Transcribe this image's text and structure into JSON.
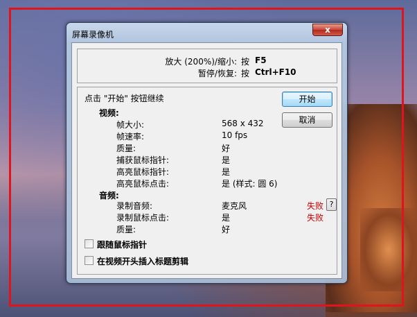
{
  "window": {
    "title": "屏幕录像机",
    "close_glyph": "x"
  },
  "hotkeys": {
    "zoom_label": "放大 (200%)/缩小:",
    "zoom_press": "按",
    "zoom_key": "F5",
    "pause_label": "暂停/恢复:",
    "pause_press": "按",
    "pause_key": "Ctrl+F10"
  },
  "instruction": "点击 \"开始\" 按钮继续",
  "buttons": {
    "start": "开始",
    "cancel": "取消"
  },
  "video": {
    "heading": "视频:",
    "rows": [
      {
        "label": "帧大小:",
        "value": "568 x 432"
      },
      {
        "label": "帧速率:",
        "value": "10 fps"
      },
      {
        "label": "质量:",
        "value": "好"
      },
      {
        "label": "捕获鼠标指针:",
        "value": "是"
      },
      {
        "label": "高亮鼠标指针:",
        "value": "是"
      },
      {
        "label": "高亮鼠标点击:",
        "value": "是 (样式: 圆 6)"
      }
    ]
  },
  "audio": {
    "heading": "音频:",
    "rows": [
      {
        "label": "录制音频:",
        "value": "麦克风",
        "status": "失败"
      },
      {
        "label": "录制鼠标点击:",
        "value": "是",
        "status": "失败"
      },
      {
        "label": "质量:",
        "value": "好"
      }
    ],
    "help_label": "?"
  },
  "options": {
    "follow_pointer": {
      "label": "跟随鼠标指针",
      "checked": false
    },
    "insert_title_clip": {
      "label": "在视频开头插入标题剪辑",
      "checked": false
    }
  },
  "colors": {
    "capture_frame": "#e0141c",
    "fail_text": "#c00000"
  }
}
